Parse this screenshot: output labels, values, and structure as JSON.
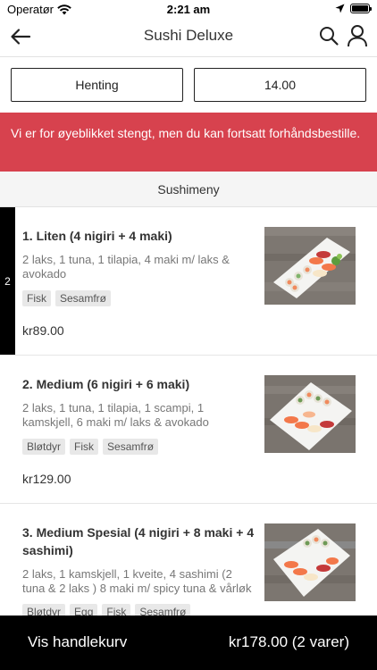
{
  "status_bar": {
    "carrier": "Operatør",
    "time": "2:21 am"
  },
  "nav": {
    "title": "Sushi Deluxe",
    "icons": [
      "arrow-left-icon",
      "search-icon",
      "user-icon"
    ]
  },
  "order_options": {
    "mode": "Henting",
    "time": "14.00"
  },
  "closed_notice": "Vi er for øyeblikket stengt, men du kan fortsatt forhåndsbestille.",
  "section_title": "Sushimeny",
  "menu_items": [
    {
      "qty": "2",
      "name": "1. Liten (4 nigiri + 4 maki)",
      "description": "2 laks, 1 tuna, 1 tilapia, 4 maki m/ laks & avokado",
      "tags": [
        "Fisk",
        "Sesamfrø"
      ],
      "price": "kr89.00"
    },
    {
      "qty": "",
      "name": "2. Medium (6 nigiri + 6 maki)",
      "description": "2 laks, 1 tuna, 1 tilapia, 1 scampi, 1 kamskjell, 6 maki m/ laks & avokado",
      "tags": [
        "Bløtdyr",
        "Fisk",
        "Sesamfrø"
      ],
      "price": "kr129.00"
    },
    {
      "qty": "",
      "name": "3. Medium Spesial (4 nigiri + 8 maki + 4 sashimi)",
      "description": "2 laks, 1 kamskjell, 1 kveite, 4 sashimi (2 tuna & 2 laks ) 8 maki m/ spicy tuna & vårløk",
      "tags": [
        "Bløtdyr",
        "Egg",
        "Fisk",
        "Sesamfrø"
      ],
      "price": ""
    }
  ],
  "cart": {
    "label": "Vis handlekurv",
    "total": "kr178.00 (2 varer)"
  },
  "colors": {
    "banner_red": "#d7424e",
    "cart_bar": "#000000",
    "tag_bg": "#e8e8e8"
  }
}
